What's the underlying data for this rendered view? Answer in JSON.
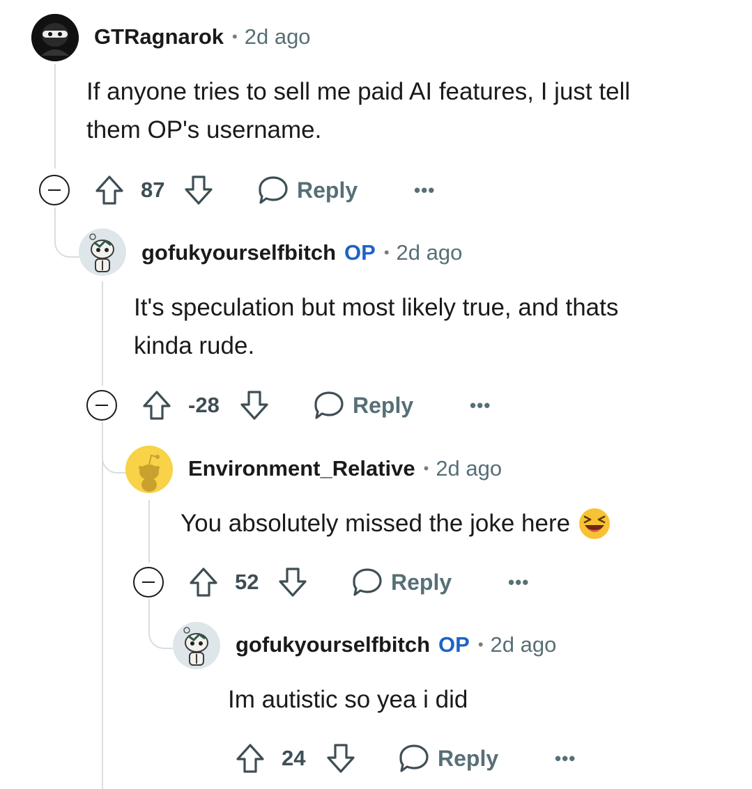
{
  "comments": [
    {
      "username": "GTRagnarok",
      "op": "",
      "separator": "•",
      "time": "2d ago",
      "body": [
        "If anyone tries to sell me paid AI features, I just tell",
        "them OP's username."
      ],
      "score": "87",
      "reply_label": "Reply",
      "more_label": "•••",
      "avatar": "ninja-avatar-icon"
    },
    {
      "username": "gofukyourselfbitch",
      "op": "OP",
      "separator": "•",
      "time": "2d ago",
      "body": [
        "It's speculation but most likely true, and thats",
        "kinda rude."
      ],
      "score": "-28",
      "reply_label": "Reply",
      "more_label": "•••",
      "avatar": "snoo-custom-avatar-icon"
    },
    {
      "username": "Environment_Relative",
      "op": "",
      "separator": "•",
      "time": "2d ago",
      "body": [
        "You absolutely missed the joke here"
      ],
      "emoji": "laughing-face-emoji",
      "score": "52",
      "reply_label": "Reply",
      "more_label": "•••",
      "avatar": "default-snoo-avatar-icon"
    },
    {
      "username": "gofukyourselfbitch",
      "op": "OP",
      "separator": "•",
      "time": "2d ago",
      "body": [
        "Im autistic so yea i did"
      ],
      "score": "24",
      "reply_label": "Reply",
      "more_label": "•••",
      "avatar": "snoo-custom-avatar-icon"
    }
  ],
  "colors": {
    "op_badge": "#1f63c3",
    "meta_text": "#576f76",
    "thread_line": "#d9dde0",
    "default_avatar_bg": "#f8d247"
  }
}
